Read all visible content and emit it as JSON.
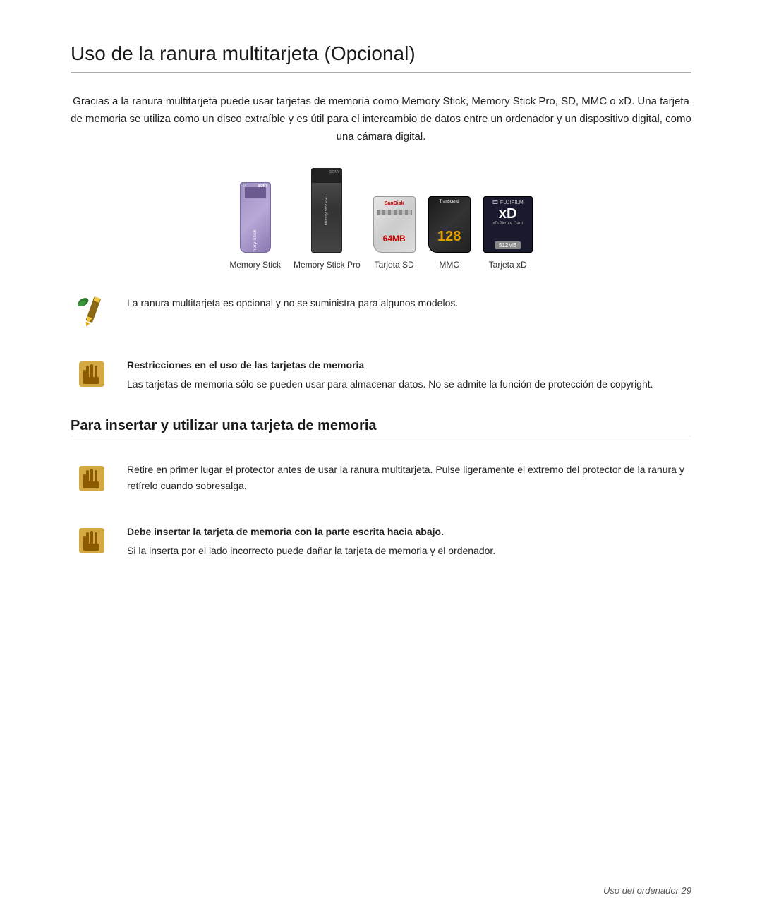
{
  "page": {
    "title": "Uso de la ranura multitarjeta (Opcional)",
    "intro": "Gracias a la ranura multitarjeta puede usar tarjetas de memoria como Memory Stick, Memory Stick Pro, SD, MMC o xD. Una tarjeta de memoria se utiliza como un disco extraíble y es útil para el intercambio de datos entre un ordenador y un dispositivo digital, como una cámara digital.",
    "cards": [
      {
        "label": "Memory Stick"
      },
      {
        "label": "Memory Stick Pro"
      },
      {
        "label": "Tarjeta SD"
      },
      {
        "label": "MMC"
      },
      {
        "label": "Tarjeta xD"
      }
    ],
    "note1": {
      "text": "La ranura multitarjeta es opcional y no se suministra para algunos modelos."
    },
    "note2": {
      "title": "Restricciones en el uso de las tarjetas de memoria",
      "text": "Las tarjetas de memoria sólo se pueden usar para almacenar datos. No se admite la función de protección de copyright."
    },
    "section2_title": "Para insertar y utilizar una tarjeta de memoria",
    "note3": {
      "text": "Retire en primer lugar el protector antes de usar la ranura multitarjeta. Pulse ligeramente el extremo del protector de la ranura y retírelo cuando sobresalga."
    },
    "note4": {
      "title": "Debe insertar la tarjeta de memoria con la parte escrita hacia abajo.",
      "text": "Si la inserta por el lado incorrecto puede dañar la tarjeta de memoria y el ordenador."
    },
    "footer": "Uso del ordenador  29"
  }
}
